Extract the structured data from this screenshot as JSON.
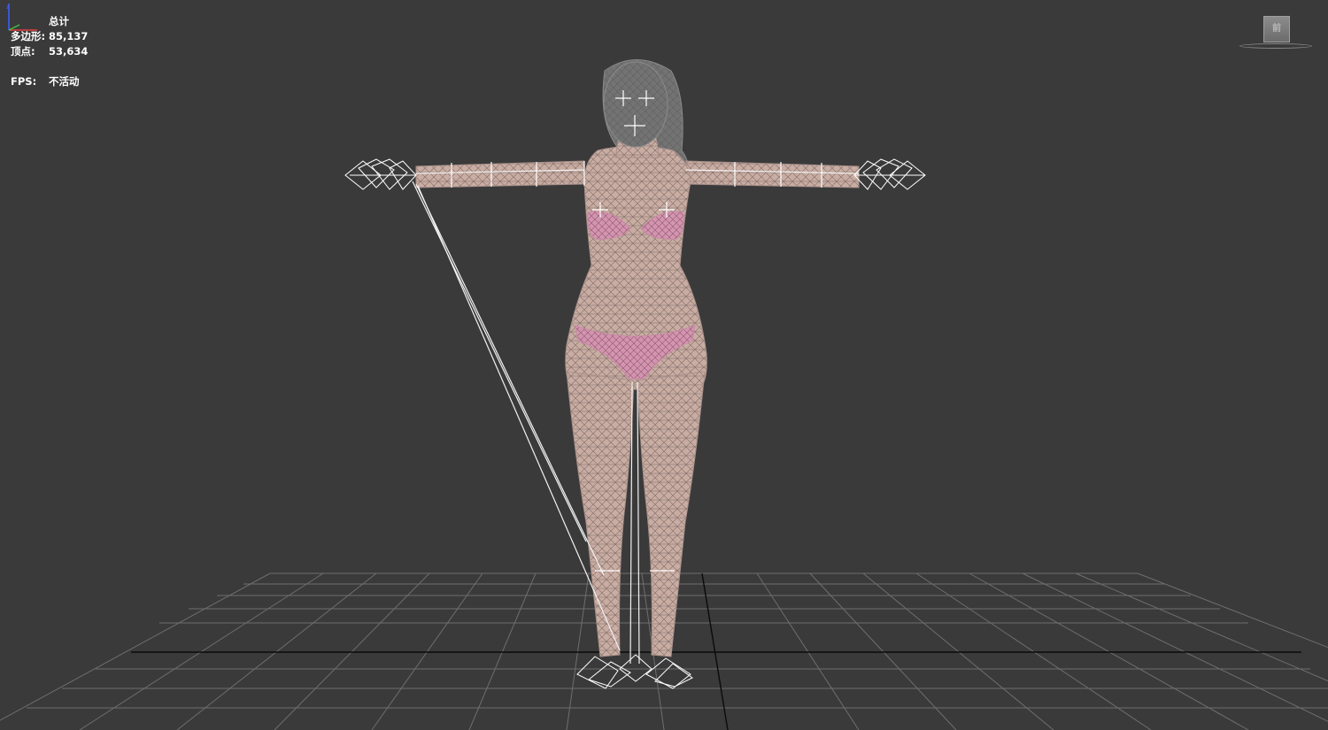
{
  "viewport": {
    "background": "#3a3a3a",
    "stats": {
      "header": "总计",
      "polygons_label": "多边形:",
      "polygons_value": "85,137",
      "vertices_label": "顶点:",
      "vertices_value": "53,634",
      "fps_label": "FPS:",
      "fps_value": "不活动"
    },
    "viewcube": {
      "face_label": "前"
    },
    "model": {
      "name": "",
      "display": "wireframe",
      "skin_color": "#c8aaa0",
      "wire_color": "#7e6e68",
      "underwear_color": "#d98fae"
    },
    "grid": {
      "line_color": "#6a6a6a",
      "axis_color": "#000000"
    },
    "axis_tripod": {
      "x_color": "#e04040",
      "y_color": "#40c040",
      "z_color": "#4060ff"
    }
  }
}
